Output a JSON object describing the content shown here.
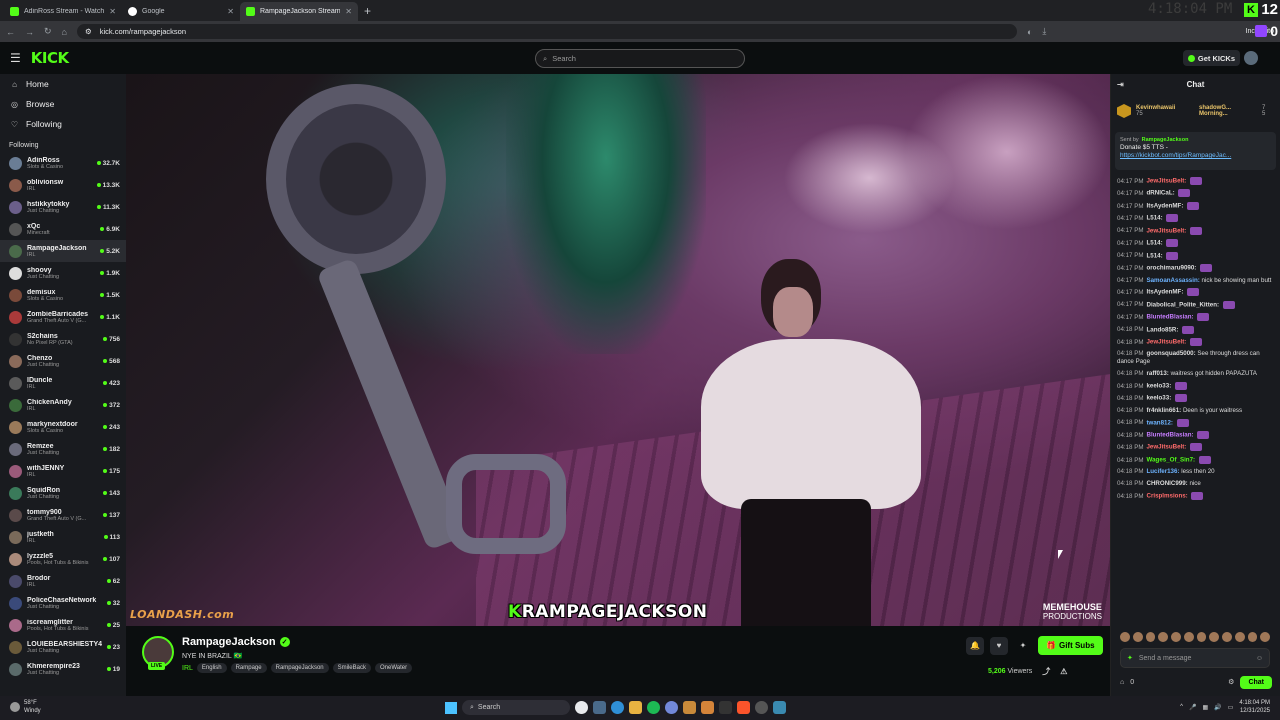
{
  "browser": {
    "tabs": [
      {
        "title": "AdinRoss Stream - Watch Live",
        "active": false,
        "icon": "kick-icon"
      },
      {
        "title": "Google",
        "active": false,
        "icon": "google-icon"
      },
      {
        "title": "RampageJackson Stream - W",
        "active": true,
        "icon": "kick-icon"
      }
    ],
    "url": "kick.com/rampagejackson",
    "incognito_label": "Incognito",
    "clock_ghost": "4:18:04 PM",
    "kick_count": "12",
    "twitch_count": "0"
  },
  "header": {
    "logo": "KICK",
    "search_placeholder": "Search",
    "get_kicks": "Get KICKs"
  },
  "sidebar": {
    "nav": [
      {
        "label": "Home",
        "icon": "home-icon"
      },
      {
        "label": "Browse",
        "icon": "compass-icon"
      },
      {
        "label": "Following",
        "icon": "heart-icon"
      }
    ],
    "following_heading": "Following",
    "channels": [
      {
        "name": "AdinRoss",
        "category": "Slots & Casino",
        "viewers": "32.7K",
        "color": "#6a7d95"
      },
      {
        "name": "oblivionsw",
        "category": "IRL",
        "viewers": "13.3K",
        "color": "#8a5a4a"
      },
      {
        "name": "hstikkytokky",
        "category": "Just Chatting",
        "viewers": "11.3K",
        "color": "#6b5f8a"
      },
      {
        "name": "xQc",
        "category": "Minecraft",
        "viewers": "6.9K",
        "color": "#555"
      },
      {
        "name": "RampageJackson",
        "category": "IRL",
        "viewers": "5.2K",
        "color": "#4a6a4a"
      },
      {
        "name": "shoovy",
        "category": "Just Chatting",
        "viewers": "1.9K",
        "color": "#ddd"
      },
      {
        "name": "demisux",
        "category": "Slots & Casino",
        "viewers": "1.5K",
        "color": "#7a4a3a"
      },
      {
        "name": "ZombieBarricades",
        "category": "Grand Theft Auto V (G...",
        "viewers": "1.1K",
        "color": "#aa3a3a"
      },
      {
        "name": "S2chains",
        "category": "No Pixel RP (GTA)",
        "viewers": "756",
        "color": "#333"
      },
      {
        "name": "Chenzo",
        "category": "Just Chatting",
        "viewers": "568",
        "color": "#8a6a5a"
      },
      {
        "name": "IDuncle",
        "category": "IRL",
        "viewers": "423",
        "color": "#5a5a5a"
      },
      {
        "name": "ChickenAndy",
        "category": "IRL",
        "viewers": "372",
        "color": "#3a6a3a"
      },
      {
        "name": "markynextdoor",
        "category": "Slots & Casino",
        "viewers": "243",
        "color": "#9a7a5a"
      },
      {
        "name": "Remzee",
        "category": "Just Chatting",
        "viewers": "182",
        "color": "#6a6a7a"
      },
      {
        "name": "withJENNY",
        "category": "IRL",
        "viewers": "175",
        "color": "#9a5a7a"
      },
      {
        "name": "SquidRon",
        "category": "Just Chatting",
        "viewers": "143",
        "color": "#3a7a5a"
      },
      {
        "name": "tommy900",
        "category": "Grand Theft Auto V (G...",
        "viewers": "137",
        "color": "#5a4a4a"
      },
      {
        "name": "justketh",
        "category": "IRL",
        "viewers": "113",
        "color": "#7a6a5a"
      },
      {
        "name": "lyzzzle5",
        "category": "Pools, Hot Tubs & Bikinis",
        "viewers": "107",
        "color": "#aa8a7a"
      },
      {
        "name": "Brodor",
        "category": "IRL",
        "viewers": "62",
        "color": "#4a4a6a"
      },
      {
        "name": "PoliceChaseNetwork",
        "category": "Just Chatting",
        "viewers": "32",
        "color": "#3a4a7a"
      },
      {
        "name": "iscreamglitter",
        "category": "Pools, Hot Tubs & Bikinis",
        "viewers": "25",
        "color": "#aa6a8a"
      },
      {
        "name": "LOUIEBEARSHIESTY4",
        "category": "Just Chatting",
        "viewers": "23",
        "color": "#6a5a3a"
      },
      {
        "name": "Khmerempire23",
        "category": "Just Chatting",
        "viewers": "19",
        "color": "#5a6a6a"
      }
    ]
  },
  "player": {
    "overlay_left": "LOANDASH.com",
    "overlay_center_k": "K",
    "overlay_center": "RAMPAGEJACKSON",
    "overlay_right_1": "MEMEHOUSE",
    "overlay_right_2": "PRODUCTIONS"
  },
  "stream": {
    "name": "RampageJackson",
    "live": "LIVE",
    "title": "NYE IN BRAZIL 🇧🇷",
    "category": "IRL",
    "tags": [
      "English",
      "Rampage",
      "RampageJackson",
      "SmileBack",
      "OneWater"
    ],
    "gift_label": "Gift Subs",
    "viewers": "5,206",
    "viewers_label": "Viewers"
  },
  "chat": {
    "title": "Chat",
    "gifters": [
      {
        "name": "Kevinwhawaii",
        "val": "75"
      },
      {
        "name": "shadowG...",
        "val": "7"
      },
      {
        "name": "Morning...",
        "val": "5"
      }
    ],
    "pinned": {
      "sent_by": "Sent by",
      "author": "RampageJackson",
      "text": "Donate $5 TTS -",
      "link": "https://kickbot.com/tips/RampageJac..."
    },
    "messages": [
      {
        "t": "04:17 PM",
        "u": "JewJitsuBelt:",
        "c": "#ff6b6b",
        "m": ""
      },
      {
        "t": "04:17 PM",
        "u": "dRNICaL:",
        "c": "#ddd",
        "m": ""
      },
      {
        "t": "04:17 PM",
        "u": "ItsAydenMF:",
        "c": "#ddd",
        "m": ""
      },
      {
        "t": "04:17 PM",
        "u": "L514:",
        "c": "#ddd",
        "m": ""
      },
      {
        "t": "04:17 PM",
        "u": "JewJitsuBelt:",
        "c": "#ff6b6b",
        "m": ""
      },
      {
        "t": "04:17 PM",
        "u": "L514:",
        "c": "#ddd",
        "m": ""
      },
      {
        "t": "04:17 PM",
        "u": "L514:",
        "c": "#ddd",
        "m": ""
      },
      {
        "t": "04:17 PM",
        "u": "orochimaru9090:",
        "c": "#ddd",
        "m": ""
      },
      {
        "t": "04:17 PM",
        "u": "SamoanAssassin:",
        "c": "#6db3ff",
        "m": "nick be showing man butt"
      },
      {
        "t": "04:17 PM",
        "u": "ItsAydenMF:",
        "c": "#ddd",
        "m": ""
      },
      {
        "t": "04:17 PM",
        "u": "Diabolical_Polite_Kitten:",
        "c": "#ddd",
        "m": ""
      },
      {
        "t": "04:17 PM",
        "u": "BluntedBlasian:",
        "c": "#c77dff",
        "m": ""
      },
      {
        "t": "04:18 PM",
        "u": "Lando85R:",
        "c": "#ddd",
        "m": ""
      },
      {
        "t": "04:18 PM",
        "u": "JewJitsuBelt:",
        "c": "#ff6b6b",
        "m": ""
      },
      {
        "t": "04:18 PM",
        "u": "goonsquad5000:",
        "c": "#ddd",
        "m": "See through dress can dance Page"
      },
      {
        "t": "04:18 PM",
        "u": "raff013:",
        "c": "#ddd",
        "m": "waitress got hidden PAPAZUTA"
      },
      {
        "t": "04:18 PM",
        "u": "keelo33:",
        "c": "#ddd",
        "m": ""
      },
      {
        "t": "04:18 PM",
        "u": "keelo33:",
        "c": "#ddd",
        "m": ""
      },
      {
        "t": "04:18 PM",
        "u": "fr4nklin661:",
        "c": "#ddd",
        "m": "Deen is your waitress"
      },
      {
        "t": "04:18 PM",
        "u": "twan812:",
        "c": "#6db3ff",
        "m": ""
      },
      {
        "t": "04:18 PM",
        "u": "BluntedBlasian:",
        "c": "#c77dff",
        "m": ""
      },
      {
        "t": "04:18 PM",
        "u": "JewJitsuBelt:",
        "c": "#ff6b6b",
        "m": ""
      },
      {
        "t": "04:18 PM",
        "u": "Wages_Of_Sin7:",
        "c": "#53fc18",
        "m": ""
      },
      {
        "t": "04:18 PM",
        "u": "Lucifer136:",
        "c": "#6db3ff",
        "m": "less then 20"
      },
      {
        "t": "04:18 PM",
        "u": "CHRONIC999:",
        "c": "#ddd",
        "m": "nice"
      },
      {
        "t": "04:18 PM",
        "u": "Crisplmsions:",
        "c": "#ff6b6b",
        "m": ""
      }
    ],
    "input_placeholder": "Send a message",
    "points": "0",
    "send_label": "Chat"
  },
  "taskbar": {
    "temp": "58°F",
    "weather": "Windy",
    "search": "Search",
    "time": "4:18:04 PM",
    "date": "12/31/2025"
  }
}
